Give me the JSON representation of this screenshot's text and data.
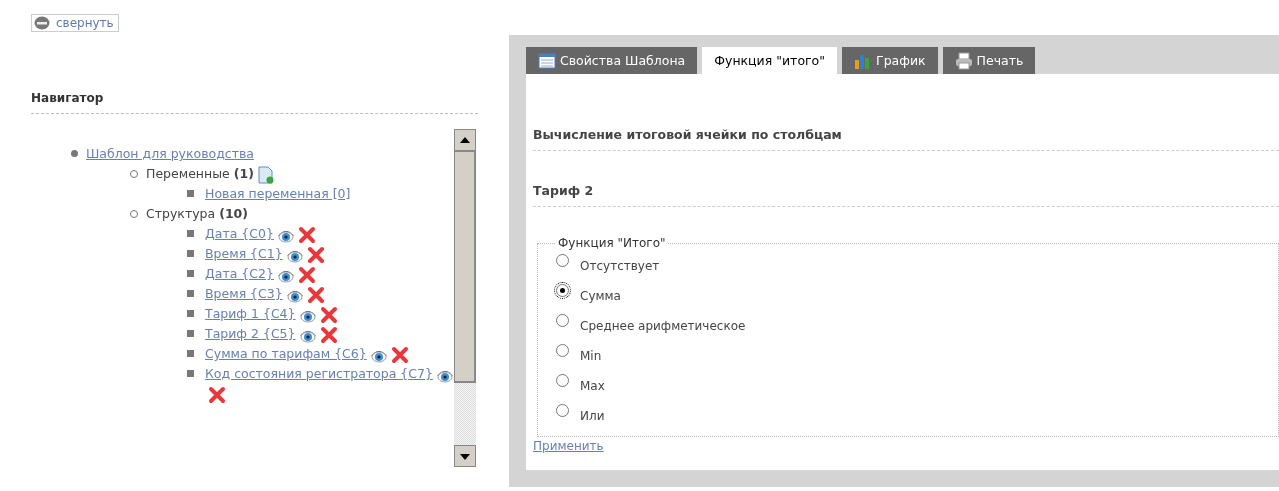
{
  "collapse_button": {
    "label": "свернуть"
  },
  "navigator": {
    "title": "Навигатор",
    "tree": [
      {
        "label": "Шаблон для руководства",
        "kind": "link",
        "children": [
          {
            "label": "Переменные",
            "count": "(1)",
            "kind": "addable",
            "children": [
              {
                "label": "Новая переменная [0]",
                "kind": "variable"
              }
            ]
          },
          {
            "label": "Структура",
            "count": "(10)",
            "kind": "group",
            "children": [
              {
                "label": "Дата {C0}",
                "kind": "column"
              },
              {
                "label": "Время {C1}",
                "kind": "column"
              },
              {
                "label": "Дата {C2}",
                "kind": "column"
              },
              {
                "label": "Время {C3}",
                "kind": "column"
              },
              {
                "label": "Тариф 1 {C4}",
                "kind": "column"
              },
              {
                "label": "Тариф 2 {C5}",
                "kind": "column"
              },
              {
                "label": "Сумма по тарифам {C6}",
                "kind": "column"
              },
              {
                "label": "Код состояния регистратора {C7}",
                "kind": "column"
              }
            ]
          }
        ]
      }
    ]
  },
  "tabs": [
    {
      "label": "Свойства Шаблона",
      "kind": "table",
      "selected": false
    },
    {
      "label": "Функция \"итого\"",
      "kind": "plain",
      "selected": true
    },
    {
      "label": "График",
      "kind": "chart",
      "selected": false
    },
    {
      "label": "Печать",
      "kind": "printer",
      "selected": false
    }
  ],
  "panel": {
    "heading": "Вычисление итоговой ячейки по столбцам",
    "column_title": "Тариф 2",
    "fieldset": {
      "legend": "Функция \"Итого\"",
      "options": [
        {
          "label": "Отсутствует",
          "selected": false
        },
        {
          "label": "Сумма",
          "selected": true
        },
        {
          "label": "Среднее арифметическое",
          "selected": false
        },
        {
          "label": "Min",
          "selected": false
        },
        {
          "label": "Max",
          "selected": false
        },
        {
          "label": "Или",
          "selected": false
        }
      ]
    },
    "apply_link": "Применить"
  }
}
